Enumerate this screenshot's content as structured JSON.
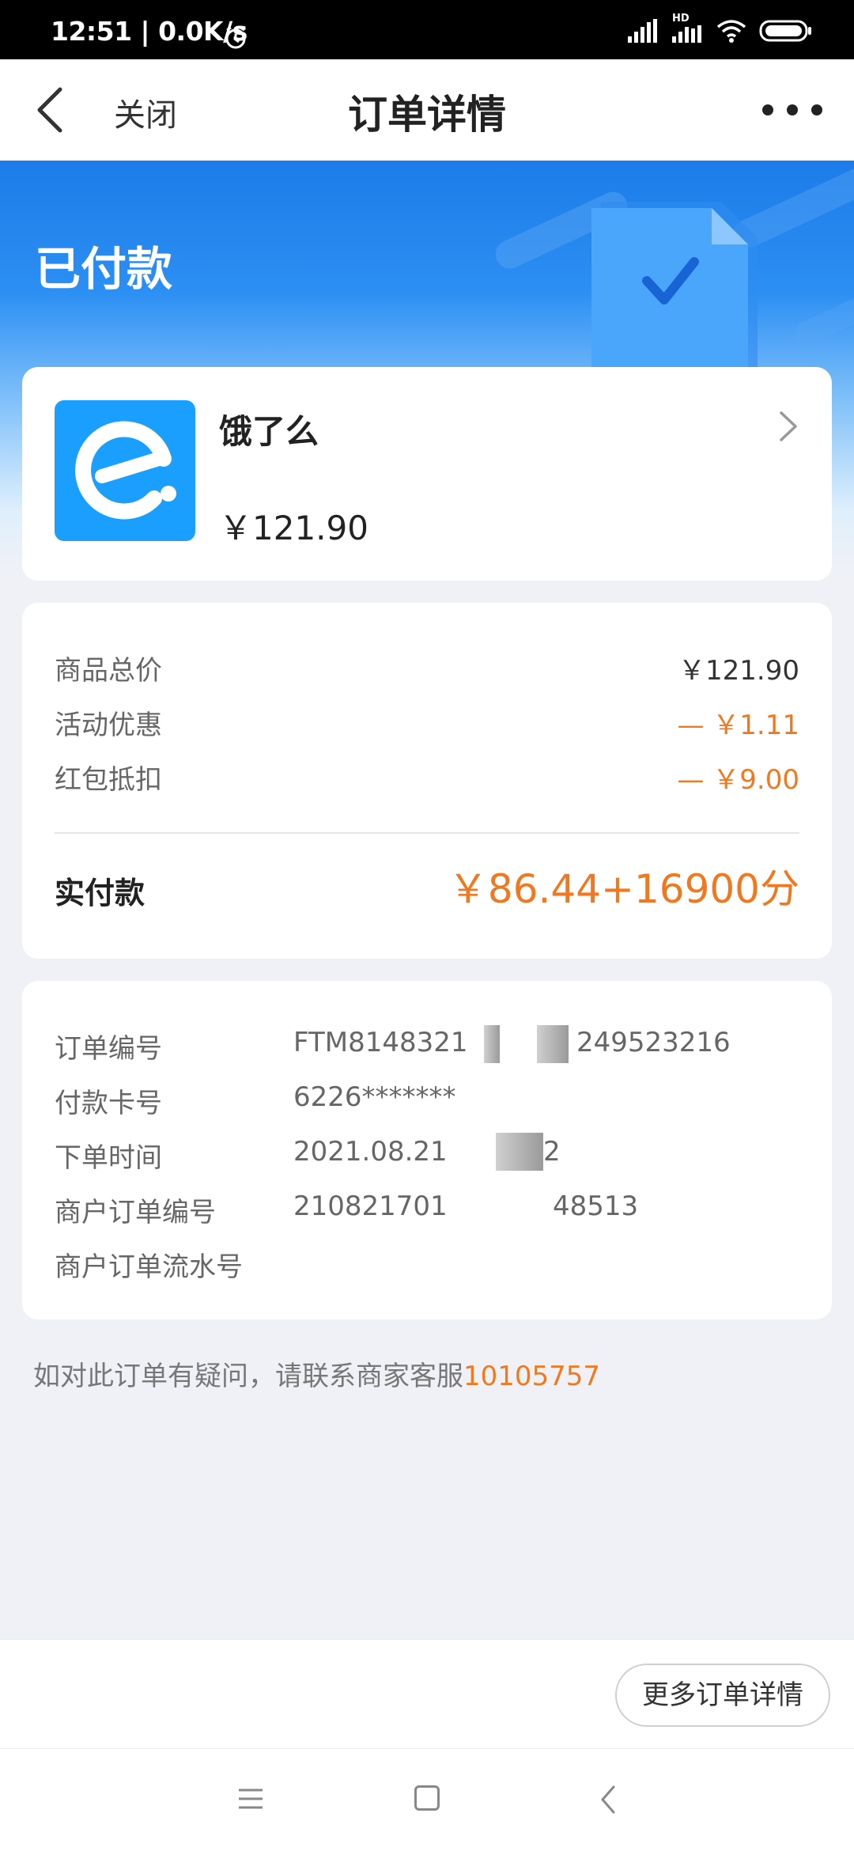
{
  "status_bar": {
    "time": "12:51 | 0.0K/s",
    "network_label": "HD"
  },
  "nav": {
    "close_label": "关闭",
    "title": "订单详情"
  },
  "hero": {
    "status": "已付款"
  },
  "merchant": {
    "name": "饿了么",
    "amount": "￥121.90"
  },
  "price_breakdown": {
    "rows": [
      {
        "label": "商品总价",
        "value": "￥121.90"
      },
      {
        "label": "活动优惠",
        "value": "— ￥1.11"
      },
      {
        "label": "红包抵扣",
        "value": "— ￥9.00"
      }
    ],
    "paid_label": "实付款",
    "paid_value": "￥86.44+16900分"
  },
  "order_info": {
    "rows": [
      {
        "label": "订单编号",
        "value": "FTM8148321",
        "value_tail": "249523216"
      },
      {
        "label": "付款卡号",
        "value": "6226*******"
      },
      {
        "label": "下单时间",
        "value": "2021.08.21",
        "value_tail": "2"
      },
      {
        "label": "商户订单编号",
        "value": "210821701",
        "value_tail": "48513"
      },
      {
        "label": "商户订单流水号",
        "value": ""
      }
    ]
  },
  "help": {
    "text": "如对此订单有疑问，请联系商家客服",
    "phone": "10105757"
  },
  "bottom": {
    "more_details_label": "更多订单详情"
  },
  "colors": {
    "accent_orange": "#f0781e",
    "brand_blue": "#1a9fff",
    "hero_blue": "#1d7ce9"
  }
}
